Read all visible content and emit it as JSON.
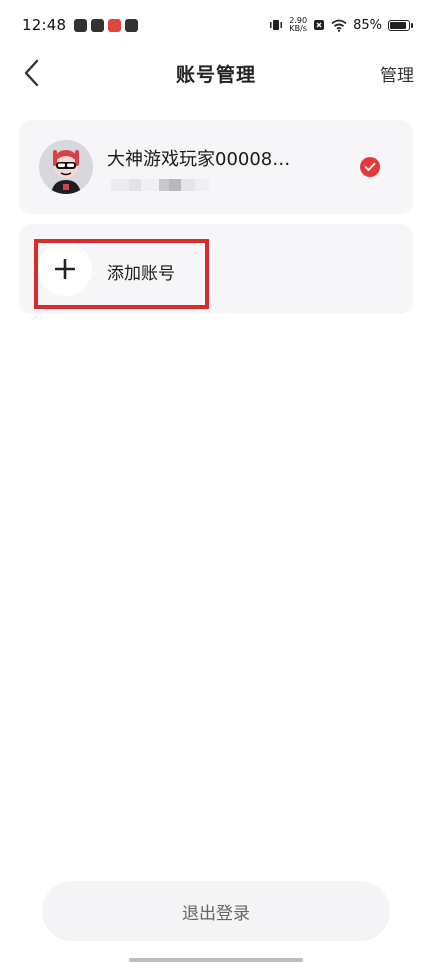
{
  "status_bar": {
    "time": "12:48",
    "net_speed_value": "2.90",
    "net_speed_unit": "KB/s",
    "battery": "85%"
  },
  "header": {
    "title": "账号管理",
    "manage_label": "管理"
  },
  "account": {
    "name": "大神游戏玩家00008…",
    "selected": true
  },
  "add_account": {
    "label": "添加账号"
  },
  "logout": {
    "label": "退出登录"
  },
  "colors": {
    "accent_red": "#e5383b",
    "highlight_red": "#d62c2c",
    "card_bg": "#f6f6f8"
  },
  "icons": {
    "back": "chevron-left-icon",
    "check": "check-icon",
    "add": "plus-icon"
  }
}
